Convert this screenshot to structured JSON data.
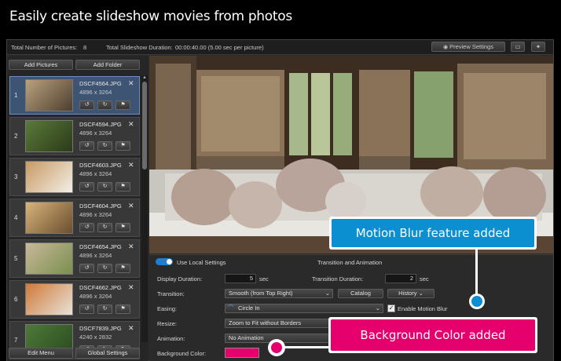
{
  "header": {
    "title": "Easily create slideshow movies from photos"
  },
  "topbar": {
    "total_pictures_label": "Total Number of Pictures:",
    "total_pictures_value": "8",
    "duration_label": "Total Slideshow Duration:",
    "duration_value": "00:00:40.00 (5.00 sec per picture)",
    "preview_settings": "Preview Settings"
  },
  "sidebar": {
    "add_pictures": "Add Pictures",
    "add_folder": "Add Folder",
    "edit_menu": "Edit Menu",
    "global_settings": "Global Settings",
    "items": [
      {
        "num": "1",
        "name": "DSCF4564.JPG",
        "dims": "4896 x 3264"
      },
      {
        "num": "2",
        "name": "DSCF4594.JPG",
        "dims": "4896 x 3264"
      },
      {
        "num": "3",
        "name": "DSCF4603.JPG",
        "dims": "4896 x 3264"
      },
      {
        "num": "4",
        "name": "DSCF4604.JPG",
        "dims": "4896 x 3264"
      },
      {
        "num": "5",
        "name": "DSCF4654.JPG",
        "dims": "4896 x 3264"
      },
      {
        "num": "6",
        "name": "DSCF4662.JPG",
        "dims": "4896 x 3264"
      },
      {
        "num": "7",
        "name": "DSCF7839.JPG",
        "dims": "4240 x 2832"
      }
    ]
  },
  "panel": {
    "use_local": "Use Local Settings",
    "section_title": "Transition and Animation",
    "display_duration_label": "Display Duration:",
    "display_duration_value": "5",
    "sec": "sec",
    "transition_duration_label": "Transition Duration:",
    "transition_duration_value": "2",
    "transition_label": "Transition:",
    "transition_value": "Smooth (from Top Right)",
    "catalog": "Catalog",
    "history": "History",
    "easing_label": "Easing:",
    "easing_value": "Circle In",
    "motion_blur": "Enable Motion Blur",
    "resize_label": "Resize:",
    "resize_value": "Zoom to Fit without Borders",
    "animation_label": "Animation:",
    "animation_value": "No Animation",
    "bg_color_label": "Background Color:"
  },
  "callouts": {
    "motion_blur": "Motion Blur feature added",
    "bg_color": "Background Color added"
  },
  "colors": {
    "motion_blur_callout": "#0b8fd0",
    "bg_callout": "#e5006e",
    "bg_color_swatch": "#e5006e",
    "selection": "#3d5573"
  }
}
